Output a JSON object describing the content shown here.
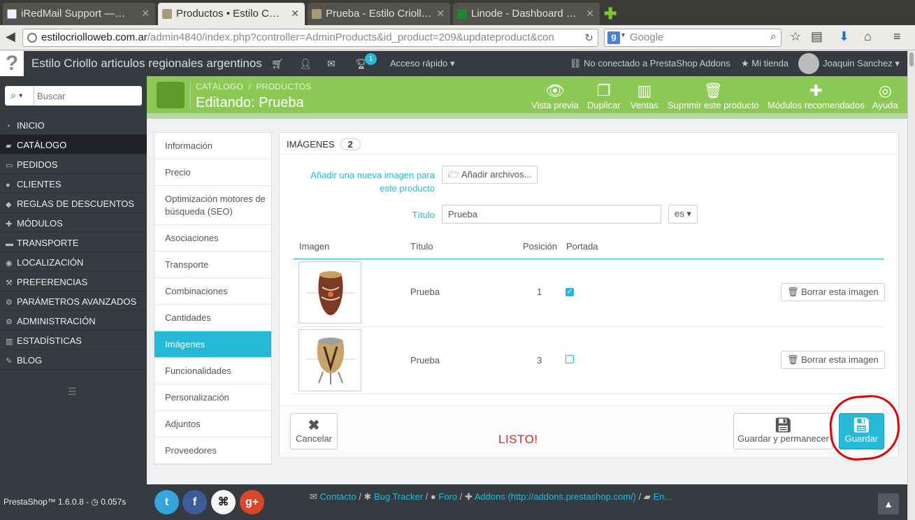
{
  "browser": {
    "tabs": [
      {
        "title": "iRedMail Support —…",
        "active": false
      },
      {
        "title": "Productos • Estilo C…",
        "active": true
      },
      {
        "title": "Prueba - Estilo Crioll…",
        "active": false
      },
      {
        "title": "Linode - Dashboard …",
        "active": false
      }
    ],
    "url_host": "estilocriolloweb.com.ar",
    "url_path": "/admin4840/index.php?controller=AdminProducts&id_product=209&updateproduct&con",
    "search_placeholder": "Google"
  },
  "header": {
    "shop_name": "Estilo Criollo articulos regionales argentinos",
    "notifications_count": "1",
    "quick_access": "Acceso rápido",
    "addons_status": "No conectado a PrestaShop Addons",
    "my_shop": "Mi tienda",
    "user_name": "Joaquin Sanchez"
  },
  "sidebar": {
    "search_placeholder": "Buscar",
    "items": [
      {
        "label": "INICIO",
        "icon": "dashboard-icon",
        "active": false
      },
      {
        "label": "CATÁLOGO",
        "icon": "book-icon",
        "active": true
      },
      {
        "label": "PEDIDOS",
        "icon": "credit-card-icon",
        "active": false
      },
      {
        "label": "CLIENTES",
        "icon": "users-icon",
        "active": false
      },
      {
        "label": "REGLAS DE DESCUENTOS",
        "icon": "tag-icon",
        "active": false
      },
      {
        "label": "MÓDULOS",
        "icon": "puzzle-icon",
        "active": false
      },
      {
        "label": "TRANSPORTE",
        "icon": "truck-icon",
        "active": false
      },
      {
        "label": "LOCALIZACIÓN",
        "icon": "globe-icon",
        "active": false
      },
      {
        "label": "PREFERENCIAS",
        "icon": "wrench-icon",
        "active": false
      },
      {
        "label": "PARÁMETROS AVANZADOS",
        "icon": "cogs-icon",
        "active": false
      },
      {
        "label": "ADMINISTRACIÓN",
        "icon": "cog-icon",
        "active": false
      },
      {
        "label": "ESTADÍSTICAS",
        "icon": "bar-chart-icon",
        "active": false
      },
      {
        "label": "BLOG",
        "icon": "edit-icon",
        "active": false
      }
    ]
  },
  "toolbar": {
    "breadcrumb_1": "CATÁLOGO",
    "breadcrumb_sep": "/",
    "breadcrumb_2": "PRODUCTOS",
    "title": "Editando: Prueba",
    "buttons": [
      {
        "label": "Vista previa",
        "icon": "eye-icon"
      },
      {
        "label": "Duplicar",
        "icon": "copy-icon"
      },
      {
        "label": "Ventas",
        "icon": "bar-chart-icon"
      },
      {
        "label": "Suprimir este producto",
        "icon": "trash-icon"
      },
      {
        "label": "Módulos recomendados",
        "icon": "puzzle-icon"
      },
      {
        "label": "Ayuda",
        "icon": "lifebuoy-icon"
      }
    ]
  },
  "product_tabs": [
    {
      "label": "Información",
      "active": false
    },
    {
      "label": "Precio",
      "active": false
    },
    {
      "label": "Optimización motores de búsqueda (SEO)",
      "active": false
    },
    {
      "label": "Asociaciones",
      "active": false
    },
    {
      "label": "Transporte",
      "active": false
    },
    {
      "label": "Combinaciones",
      "active": false
    },
    {
      "label": "Cantidades",
      "active": false
    },
    {
      "label": "Imágenes",
      "active": true
    },
    {
      "label": "Funcionalidades",
      "active": false
    },
    {
      "label": "Personalización",
      "active": false
    },
    {
      "label": "Adjuntos",
      "active": false
    },
    {
      "label": "Proveedores",
      "active": false
    }
  ],
  "images_panel": {
    "heading": "IMÁGENES",
    "count": "2",
    "add_image_label": "Añadir una nueva imagen para este producto",
    "add_files_button": "Añadir archivos...",
    "title_label": "Título",
    "title_value": "Prueba",
    "lang": "es",
    "columns": [
      "Imagen",
      "Título",
      "Posición",
      "Portada"
    ],
    "rows": [
      {
        "title": "Prueba",
        "position": "1",
        "cover": true,
        "delete_label": "Borrar esta imagen"
      },
      {
        "title": "Prueba",
        "position": "3",
        "cover": false,
        "delete_label": "Borrar esta imagen"
      }
    ],
    "cancel_label": "Cancelar",
    "annotation": "LISTO!",
    "save_stay_label": "Guardar y permanecer",
    "save_label": "Guardar"
  },
  "footer": {
    "version": "PrestaShop™ 1.6.0.8 - ",
    "time": "0.057s",
    "links": [
      "Contacto",
      "Bug Tracker",
      "Foro",
      "Addons (http://addons.prestashop.com/)",
      "En..."
    ],
    "link_sep": " / "
  },
  "colors": {
    "accent": "#25b9d7",
    "toolbar_green": "#8bc954",
    "dark": "#363a41",
    "annotation_red": "#e32121"
  }
}
